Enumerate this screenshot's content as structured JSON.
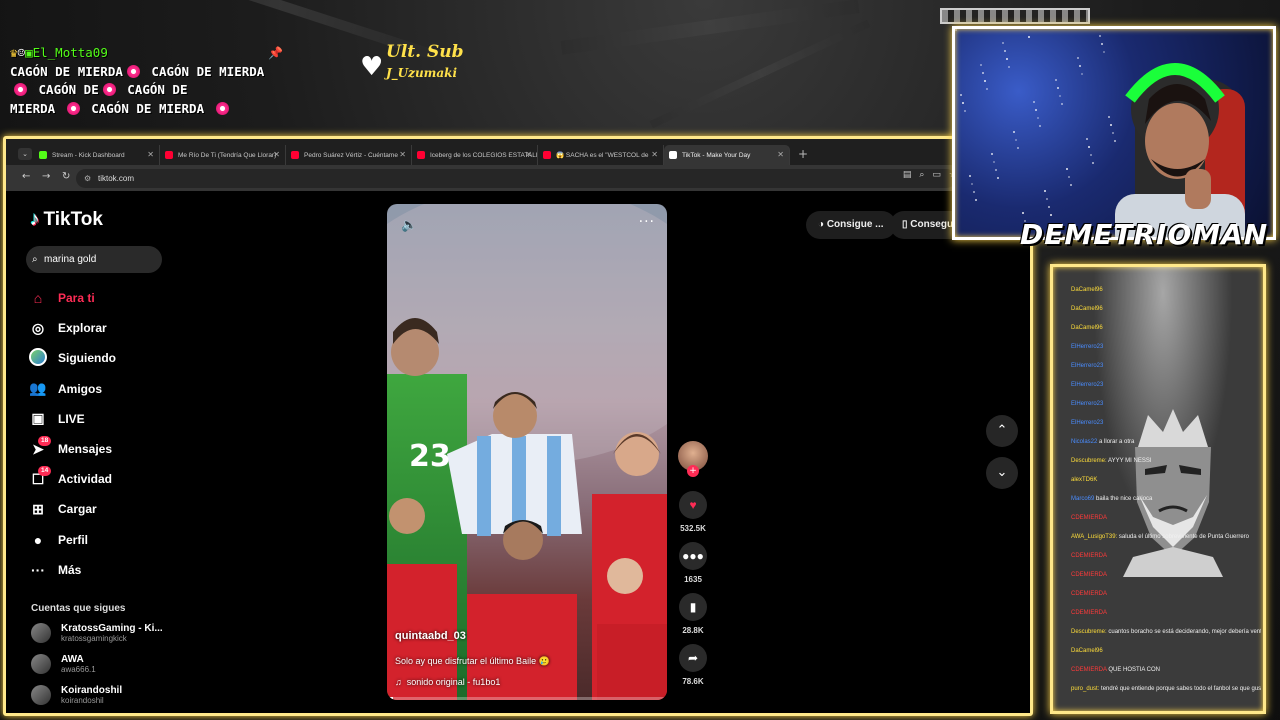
{
  "overlay": {
    "chat_user": "El_Motta09",
    "chat_lines": [
      "CAGÓN DE MIERDA",
      "CAGÓN DE MIERDA",
      "CAGÓN DE",
      "MIERDA",
      "CAGÓN DE MIERDA"
    ],
    "last_sub_label": "Ult. Sub",
    "last_sub_name": "J_Uzumaki",
    "streamer_name": "DEMETRIOMAN"
  },
  "browser": {
    "tabs": [
      {
        "title": "Stream - Kick Dashboard",
        "color": "#53fc18"
      },
      {
        "title": "Me Río De Ti (Tendría Que Llorar)",
        "color": "#ff0033"
      },
      {
        "title": "Pedro Suárez Vértiz - Cuéntame",
        "color": "#ff0033"
      },
      {
        "title": "Iceberg de los COLEGIOS ESTATALES",
        "color": "#ff0033"
      },
      {
        "title": "😱 SACHA es el \"WESTCOL de",
        "color": "#ff0033"
      },
      {
        "title": "TikTok - Make Your Day",
        "color": "#ffffff"
      }
    ],
    "url": "tiktok.com"
  },
  "tiktok": {
    "logo": "TikTok",
    "search_value": "marina gold",
    "nav": [
      {
        "label": "Para ti",
        "icon": "home-icon",
        "glyph": "⌂"
      },
      {
        "label": "Explorar",
        "icon": "compass-icon",
        "glyph": "◎"
      },
      {
        "label": "Siguiendo",
        "icon": "following-avatar-icon",
        "glyph": ""
      },
      {
        "label": "Amigos",
        "icon": "friends-icon",
        "glyph": "👥"
      },
      {
        "label": "LIVE",
        "icon": "live-icon",
        "glyph": "▣"
      },
      {
        "label": "Mensajes",
        "icon": "messages-icon",
        "glyph": "➤",
        "badge": "18"
      },
      {
        "label": "Actividad",
        "icon": "activity-icon",
        "glyph": "☐",
        "badge": "14"
      },
      {
        "label": "Cargar",
        "icon": "upload-icon",
        "glyph": "⊞"
      },
      {
        "label": "Perfil",
        "icon": "profile-icon",
        "glyph": "●"
      },
      {
        "label": "Más",
        "icon": "more-icon",
        "glyph": "···"
      }
    ],
    "following_heading": "Cuentas que sigues",
    "following": [
      {
        "name": "KratossGaming - Ki...",
        "handle": "kratossgamingkick"
      },
      {
        "name": "AWA",
        "handle": "awa666.1"
      },
      {
        "name": "Koirandoshil",
        "handle": "koirandoshil"
      }
    ],
    "pills": [
      "Consigue ...",
      "Consegui"
    ],
    "video": {
      "username": "quintaabd_03",
      "caption": "Solo ay que disfrutar el último Baile 🥲",
      "sound": "sonido original - fu1bo1",
      "jersey_number": "23",
      "progress": 0.02
    },
    "actions": [
      {
        "name": "like",
        "icon": "heart-icon",
        "glyph": "♥",
        "count": "532.5K",
        "color": "#fe2c55"
      },
      {
        "name": "comment",
        "icon": "comment-icon",
        "glyph": "●●●",
        "count": "1635",
        "color": "#ffffff"
      },
      {
        "name": "save",
        "icon": "bookmark-icon",
        "glyph": "▮",
        "count": "28.8K",
        "color": "#ffffff"
      },
      {
        "name": "share",
        "icon": "share-icon",
        "glyph": "➦",
        "count": "78.6K",
        "color": "#ffffff"
      }
    ]
  },
  "chat_panel": [
    {
      "user": "DaCamel96",
      "msg": "",
      "c": "cu-y"
    },
    {
      "user": "DaCamel96",
      "msg": "",
      "c": "cu-y"
    },
    {
      "user": "DaCamel96",
      "msg": "",
      "c": "cu-y"
    },
    {
      "user": "ElHerrero23",
      "msg": "",
      "c": "cu-b"
    },
    {
      "user": "ElHerrero23",
      "msg": "",
      "c": "cu-b"
    },
    {
      "user": "ElHerrero23",
      "msg": "",
      "c": "cu-b"
    },
    {
      "user": "ElHerrero23",
      "msg": "",
      "c": "cu-b"
    },
    {
      "user": "ElHerrero23",
      "msg": "",
      "c": "cu-b"
    },
    {
      "user": "Nicolas22",
      "msg": "a llorar a otra",
      "c": "cu-b"
    },
    {
      "user": "Descubreme:",
      "msg": "AYYY MI NESSI",
      "c": "cu-y"
    },
    {
      "user": "alexTD6K",
      "msg": "",
      "c": "cu-y"
    },
    {
      "user": "Marco69",
      "msg": "baila the nice carioca",
      "c": "cu-b"
    },
    {
      "user": "CDEMIERDA",
      "msg": "",
      "c": "cu-r"
    },
    {
      "user": "AWA_LusigoT39:",
      "msg": "saluda el último sobreviviente de Punta Guerrero",
      "c": "cu-y"
    },
    {
      "user": "CDEMIERDA",
      "msg": "",
      "c": "cu-r"
    },
    {
      "user": "CDEMIERDA",
      "msg": "",
      "c": "cu-r"
    },
    {
      "user": "CDEMIERDA",
      "msg": "",
      "c": "cu-r"
    },
    {
      "user": "CDEMIERDA",
      "msg": "",
      "c": "cu-r"
    },
    {
      "user": "Descubreme:",
      "msg": "cuantos boracho se está deciderando, mejor debería ventanear a los pexes rata",
      "c": "cu-y"
    },
    {
      "user": "DaCamel96",
      "msg": "",
      "c": "cu-y"
    },
    {
      "user": "CDEMIERDA",
      "msg": "QUE HOSTIA CON",
      "c": "cu-r"
    },
    {
      "user": "puro_dust:",
      "msg": "tendré que entiende porque sabes todo el fanbol se que gusa",
      "c": "cu-y"
    }
  ]
}
